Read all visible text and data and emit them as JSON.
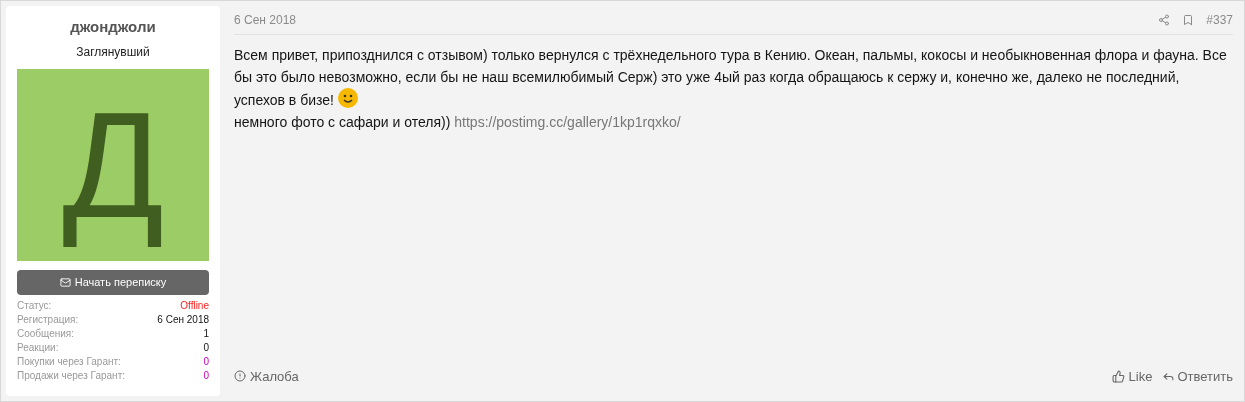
{
  "user": {
    "name": "джонджоли",
    "title": "Заглянувший",
    "avatar_letter": "Д",
    "message_button": "Начать переписку",
    "stats": [
      {
        "label": "Статус:",
        "value": "Offline",
        "kind": "status"
      },
      {
        "label": "Регистрация:",
        "value": "6 Сен 2018",
        "kind": "plain"
      },
      {
        "label": "Сообщения:",
        "value": "1",
        "kind": "plain"
      },
      {
        "label": "Реакции:",
        "value": "0",
        "kind": "plain"
      },
      {
        "label": "Покупки через Гарант:",
        "value": "0",
        "kind": "guarantee"
      },
      {
        "label": "Продажи через Гарант:",
        "value": "0",
        "kind": "guarantee"
      }
    ]
  },
  "post": {
    "date": "6 Сен 2018",
    "number": "#337",
    "paragraph": "Всем привет, припозднился с отзывом) только вернулся с трёхнедельного тура в Кению. Океан, пальмы, кокосы и необыкновенная флора и фауна. Все бы это было невозможно, если бы не наш всемилюбимый Серж) это уже 4ый раз когда обращаюсь к сержу и, конечно же, далеко не последний,",
    "line_emoji": "успехов в бизе!",
    "line2": "немного фото с сафари и отеля))",
    "link": "https://postimg.cc/gallery/1kp1rqxko/",
    "report": "Жалоба",
    "like": "Like",
    "reply": "Ответить"
  }
}
